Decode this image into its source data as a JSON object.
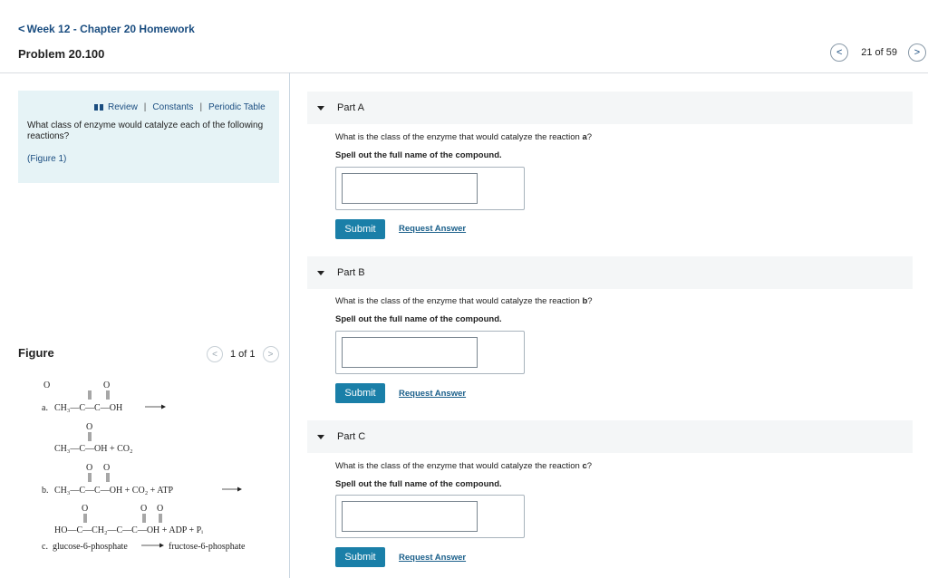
{
  "nav": {
    "back_chevron": "<",
    "back_label": "Week 12 - Chapter 20 Homework",
    "problem_title": "Problem 20.100",
    "pager_prev": "<",
    "pager_next": ">",
    "pager_count": "21 of 59"
  },
  "intro": {
    "links": [
      "Review",
      "Constants",
      "Periodic Table"
    ],
    "separator": "|",
    "prompt": "What class of enzyme would catalyze each of the following reactions?",
    "figure_link": "(Figure 1)"
  },
  "figure": {
    "title": "Figure",
    "pager_prev": "<",
    "pager_next": ">",
    "pager_count": "1 of 1",
    "reaction_a": {
      "label": "a.",
      "reactant": "CH₃—C—C—OH",
      "carbonyl_o": "O",
      "product": "CH₃—C—OH + CO₂"
    },
    "reaction_b": {
      "label": "b.",
      "reactant": "CH₃—C—C—OH + CO₂ + ATP",
      "carbonyl_o": "O",
      "product": "HO—C—CH₂—C—C—OH + ADP + Pᵢ"
    },
    "reaction_c": {
      "label": "c.",
      "reactant": "glucose-6-phosphate",
      "product": "fructose-6-phosphate"
    }
  },
  "parts": [
    {
      "label": "Part A",
      "question_prefix": "What is the class of the enzyme that would catalyze the reaction ",
      "question_letter": "a",
      "question_suffix": "?",
      "instruction": "Spell out the full name of the compound.",
      "answer_value": "",
      "submit_label": "Submit",
      "request_label": "Request Answer"
    },
    {
      "label": "Part B",
      "question_prefix": "What is the class of the enzyme that would catalyze the reaction ",
      "question_letter": "b",
      "question_suffix": "?",
      "instruction": "Spell out the full name of the compound.",
      "answer_value": "",
      "submit_label": "Submit",
      "request_label": "Request Answer"
    },
    {
      "label": "Part C",
      "question_prefix": "What is the class of the enzyme that would catalyze the reaction ",
      "question_letter": "c",
      "question_suffix": "?",
      "instruction": "Spell out the full name of the compound.",
      "answer_value": "",
      "submit_label": "Submit",
      "request_label": "Request Answer"
    }
  ],
  "icons": {
    "back": "chevron-left-icon",
    "book": "book-icon",
    "part_toggle": "caret-down-icon",
    "arrow": "arrow-right-icon"
  },
  "colors": {
    "link": "#1a4d80",
    "submit": "#1a7fa8",
    "intro_bg": "#e6f3f6",
    "part_bg": "#f4f6f7"
  }
}
